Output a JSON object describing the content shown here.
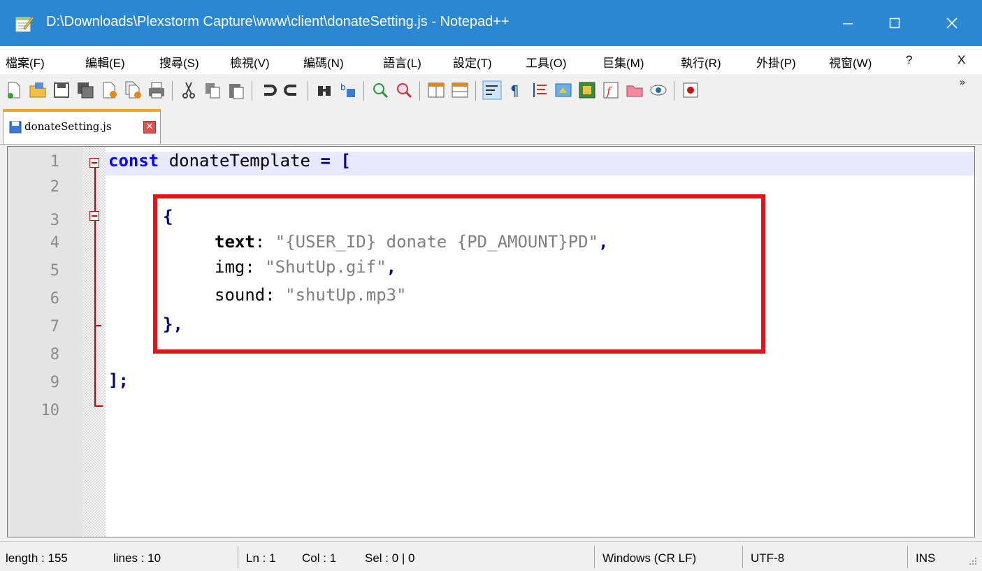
{
  "window": {
    "title": "D:\\Downloads\\Plexstorm Capture\\www\\client\\donateSetting.js - Notepad++",
    "minimize_icon": "minimize-icon",
    "maximize_icon": "maximize-icon",
    "close_icon": "close-icon"
  },
  "menu": {
    "items": [
      "檔案(F)",
      "編輯(E)",
      "搜尋(S)",
      "檢視(V)",
      "編碼(N)",
      "語言(L)",
      "設定(T)",
      "工具(O)",
      "巨集(M)",
      "執行(R)",
      "外掛(P)",
      "視窗(W)",
      "?"
    ],
    "close": "X"
  },
  "toolbar": {
    "overflow": "»"
  },
  "tab": {
    "label": "donateSetting.js",
    "close_glyph": "✕"
  },
  "editor": {
    "line_numbers": [
      "1",
      "2",
      "3",
      "4",
      "5",
      "6",
      "7",
      "8",
      "9",
      "10"
    ],
    "lines": {
      "l1_kw": "const",
      "l1_name": " donateTemplate ",
      "l1_eq": "=",
      "l1_br": " [",
      "l3": "{",
      "l4_key": "text",
      "l4_colon": ":",
      "l4_val": " \"{USER_ID} donate {PD_AMOUNT}PD\"",
      "l4_comma": ",",
      "l5_key": "img:",
      "l5_val": " \"ShutUp.gif\"",
      "l5_comma": ",",
      "l6_key": "sound:",
      "l6_val": " \"shutUp.mp3\"",
      "l7": "},",
      "l9": "];"
    }
  },
  "status": {
    "length": "length : 155",
    "lines": "lines : 10",
    "ln": "Ln : 1",
    "col": "Col : 1",
    "sel": "Sel : 0 | 0",
    "eol": "Windows (CR LF)",
    "encoding": "UTF-8",
    "mode": "INS"
  },
  "colors": {
    "titlebar": "#2b87d1",
    "highlight_box": "#e0151a",
    "keyword": "#0000ff",
    "string": "#808080",
    "tab_accent": "#f5a623"
  }
}
